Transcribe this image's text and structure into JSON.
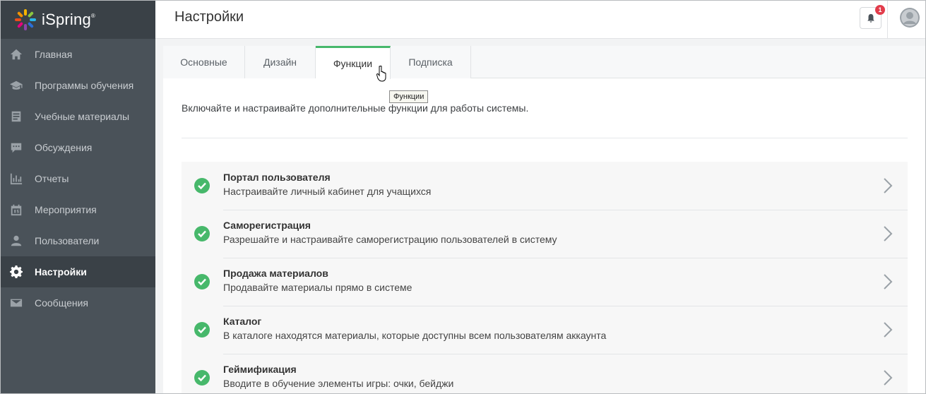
{
  "app": {
    "name": "iSpring"
  },
  "sidebar": {
    "items": [
      {
        "label": "Главная",
        "icon": "home-icon"
      },
      {
        "label": "Программы обучения",
        "icon": "graduation-cap-icon"
      },
      {
        "label": "Учебные материалы",
        "icon": "document-icon"
      },
      {
        "label": "Обсуждения",
        "icon": "chat-icon"
      },
      {
        "label": "Отчеты",
        "icon": "bar-chart-icon"
      },
      {
        "label": "Мероприятия",
        "icon": "calendar-icon"
      },
      {
        "label": "Пользователи",
        "icon": "user-icon"
      },
      {
        "label": "Настройки",
        "icon": "gear-icon",
        "active": true
      },
      {
        "label": "Сообщения",
        "icon": "envelope-icon"
      }
    ]
  },
  "header": {
    "title": "Настройки",
    "notifications_count": "1"
  },
  "tabs": [
    {
      "label": "Основные"
    },
    {
      "label": "Дизайн"
    },
    {
      "label": "Функции",
      "active": true
    },
    {
      "label": "Подписка"
    }
  ],
  "tooltip": "Функции",
  "intro": "Включайте и настраивайте дополнительные функции для работы системы.",
  "features": [
    {
      "title": "Портал пользователя",
      "description": "Настраивайте личный кабинет для учащихся",
      "enabled": true
    },
    {
      "title": "Саморегистрация",
      "description": "Разрешайте и настраивайте саморегистрацию пользователей в систему",
      "enabled": true
    },
    {
      "title": "Продажа материалов",
      "description": "Продавайте материалы прямо в системе",
      "enabled": true
    },
    {
      "title": "Каталог",
      "description": "В каталоге находятся материалы, которые доступны всем пользователям аккаунта",
      "enabled": true
    },
    {
      "title": "Геймификация",
      "description": "Вводите в обучение элементы игры: очки, бейджи",
      "enabled": true
    }
  ],
  "colors": {
    "accent": "#47b86b",
    "sidebar": "#4a5259",
    "badge": "#e23c4b"
  }
}
